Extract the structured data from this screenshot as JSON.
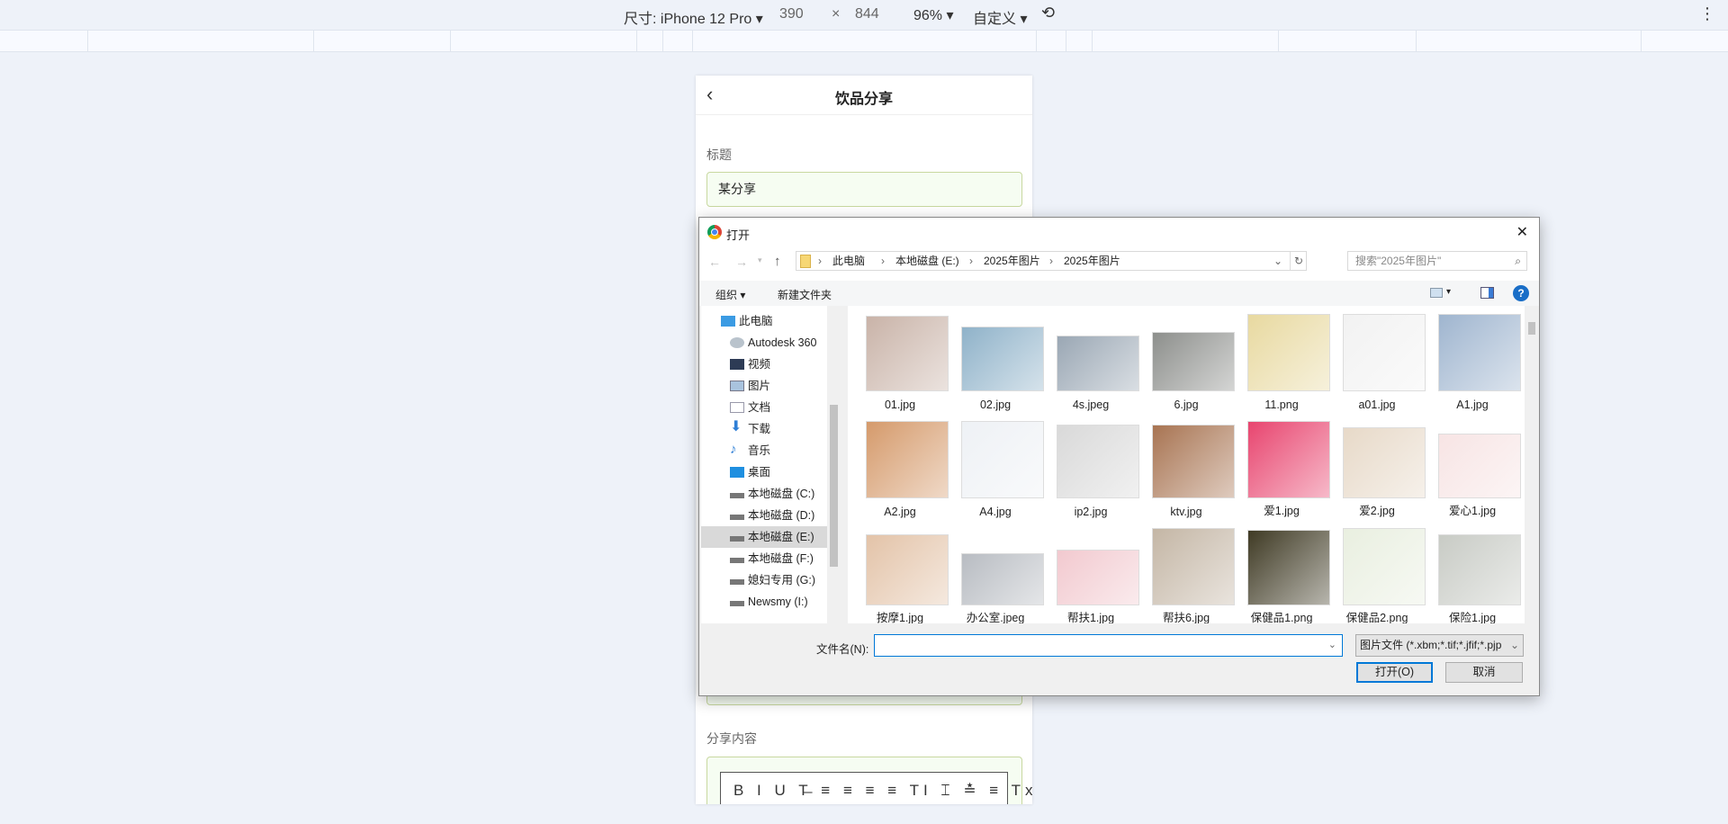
{
  "devtools": {
    "device_label": "尺寸: iPhone 12 Pro ▾",
    "width": "390",
    "times": "×",
    "height": "844",
    "zoom": "96% ▾",
    "throttle": "自定义 ▾",
    "menu": "⋮"
  },
  "phone": {
    "title": "饮品分享",
    "back": "‹",
    "title_label": "标题",
    "title_value": "某分享",
    "content_label": "分享内容",
    "editor_tools": "B I U T̶ ≡ ≡ ≡ ≡ TI ⌶ ≛ ≡ Tx"
  },
  "dialog": {
    "title": "打开",
    "close": "✕",
    "breadcrumb": [
      "此电脑",
      "本地磁盘 (E:)",
      "2025年图片",
      "2025年图片"
    ],
    "search_placeholder": "搜索\"2025年图片\"",
    "organize": "组织 ▾",
    "new_folder": "新建文件夹",
    "nav": [
      "此电脑",
      "Autodesk 360",
      "视频",
      "图片",
      "文档",
      "下载",
      "音乐",
      "桌面",
      "本地磁盘 (C:)",
      "本地磁盘 (D:)",
      "本地磁盘 (E:)",
      "本地磁盘 (F:)",
      "媳妇专用 (G:)",
      "Newsmy (I:)"
    ],
    "selected_nav": "本地磁盘 (E:)",
    "files": [
      "01.jpg",
      "02.jpg",
      "4s.jpeg",
      "6.jpg",
      "11.png",
      "a01.jpg",
      "A1.jpg",
      "A2.jpg",
      "A4.jpg",
      "ip2.jpg",
      "ktv.jpg",
      "爱1.jpg",
      "爱2.jpg",
      "爱心1.jpg",
      "按摩1.jpg",
      "办公室.jpeg",
      "帮扶1.jpg",
      "帮扶6.jpg",
      "保健品1.png",
      "保健品2.png",
      "保险1.jpg"
    ],
    "filename_label": "文件名(N):",
    "filename_value": "",
    "filetype": "图片文件 (*.xbm;*.tif;*.jfif;*.pjp",
    "open": "打开(O)",
    "cancel": "取消"
  }
}
